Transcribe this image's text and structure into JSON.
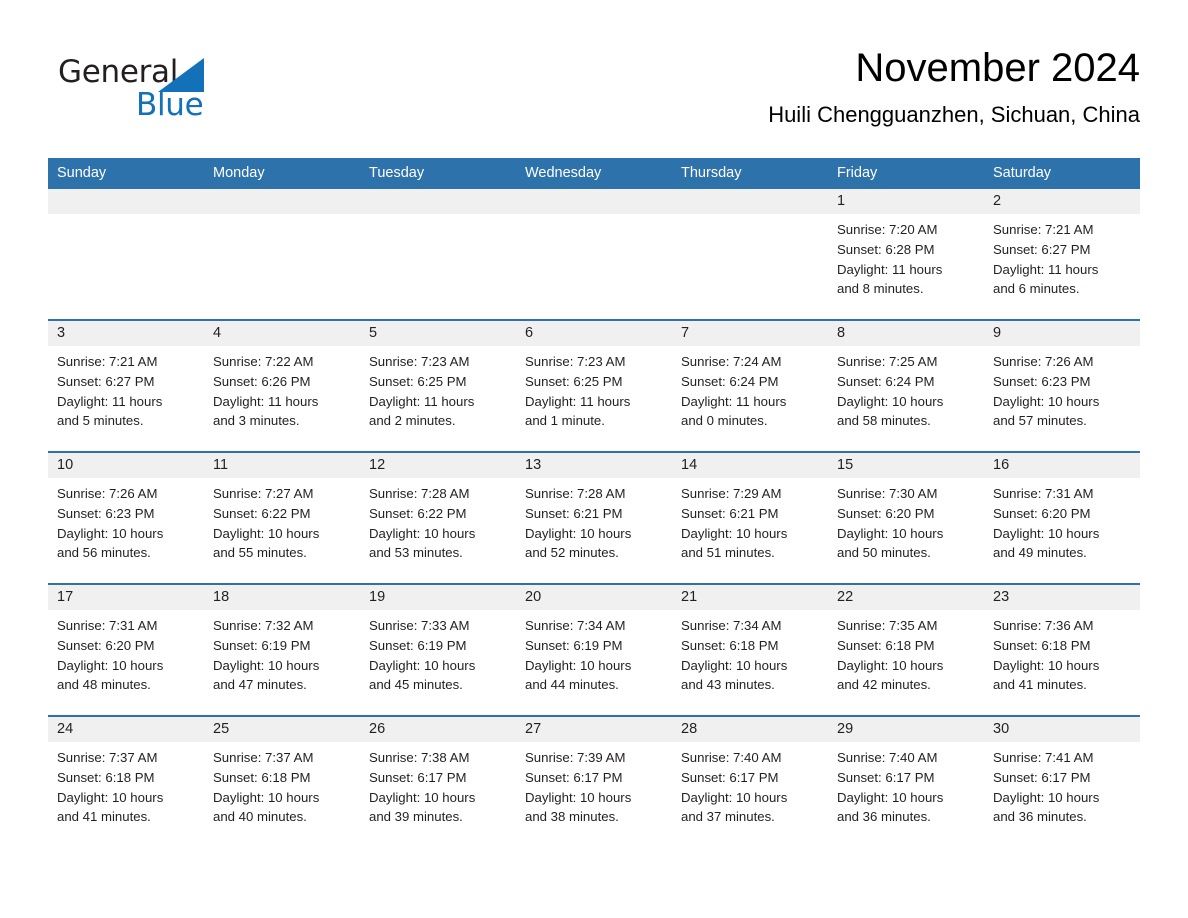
{
  "brand": {
    "word1": "General",
    "word2": "Blue",
    "triangle_color": "#1271b8",
    "text_color": "#231f20",
    "logo_icon": "triangle-play-icon"
  },
  "header": {
    "month_title": "November 2024",
    "location": "Huili Chengguanzhen, Sichuan, China"
  },
  "theme": {
    "header_blue": "#2e72ab",
    "row_divider_blue": "#2e72ab",
    "daynum_band": "#f0f0f0",
    "text": "#231f20",
    "background": "#ffffff"
  },
  "weekday_headers": [
    "Sunday",
    "Monday",
    "Tuesday",
    "Wednesday",
    "Thursday",
    "Friday",
    "Saturday"
  ],
  "weeks": [
    [
      {
        "day": "",
        "sunrise": "",
        "sunset": "",
        "daylight_1": "",
        "daylight_2": ""
      },
      {
        "day": "",
        "sunrise": "",
        "sunset": "",
        "daylight_1": "",
        "daylight_2": ""
      },
      {
        "day": "",
        "sunrise": "",
        "sunset": "",
        "daylight_1": "",
        "daylight_2": ""
      },
      {
        "day": "",
        "sunrise": "",
        "sunset": "",
        "daylight_1": "",
        "daylight_2": ""
      },
      {
        "day": "",
        "sunrise": "",
        "sunset": "",
        "daylight_1": "",
        "daylight_2": ""
      },
      {
        "day": "1",
        "sunrise": "Sunrise: 7:20 AM",
        "sunset": "Sunset: 6:28 PM",
        "daylight_1": "Daylight: 11 hours",
        "daylight_2": "and 8 minutes."
      },
      {
        "day": "2",
        "sunrise": "Sunrise: 7:21 AM",
        "sunset": "Sunset: 6:27 PM",
        "daylight_1": "Daylight: 11 hours",
        "daylight_2": "and 6 minutes."
      }
    ],
    [
      {
        "day": "3",
        "sunrise": "Sunrise: 7:21 AM",
        "sunset": "Sunset: 6:27 PM",
        "daylight_1": "Daylight: 11 hours",
        "daylight_2": "and 5 minutes."
      },
      {
        "day": "4",
        "sunrise": "Sunrise: 7:22 AM",
        "sunset": "Sunset: 6:26 PM",
        "daylight_1": "Daylight: 11 hours",
        "daylight_2": "and 3 minutes."
      },
      {
        "day": "5",
        "sunrise": "Sunrise: 7:23 AM",
        "sunset": "Sunset: 6:25 PM",
        "daylight_1": "Daylight: 11 hours",
        "daylight_2": "and 2 minutes."
      },
      {
        "day": "6",
        "sunrise": "Sunrise: 7:23 AM",
        "sunset": "Sunset: 6:25 PM",
        "daylight_1": "Daylight: 11 hours",
        "daylight_2": "and 1 minute."
      },
      {
        "day": "7",
        "sunrise": "Sunrise: 7:24 AM",
        "sunset": "Sunset: 6:24 PM",
        "daylight_1": "Daylight: 11 hours",
        "daylight_2": "and 0 minutes."
      },
      {
        "day": "8",
        "sunrise": "Sunrise: 7:25 AM",
        "sunset": "Sunset: 6:24 PM",
        "daylight_1": "Daylight: 10 hours",
        "daylight_2": "and 58 minutes."
      },
      {
        "day": "9",
        "sunrise": "Sunrise: 7:26 AM",
        "sunset": "Sunset: 6:23 PM",
        "daylight_1": "Daylight: 10 hours",
        "daylight_2": "and 57 minutes."
      }
    ],
    [
      {
        "day": "10",
        "sunrise": "Sunrise: 7:26 AM",
        "sunset": "Sunset: 6:23 PM",
        "daylight_1": "Daylight: 10 hours",
        "daylight_2": "and 56 minutes."
      },
      {
        "day": "11",
        "sunrise": "Sunrise: 7:27 AM",
        "sunset": "Sunset: 6:22 PM",
        "daylight_1": "Daylight: 10 hours",
        "daylight_2": "and 55 minutes."
      },
      {
        "day": "12",
        "sunrise": "Sunrise: 7:28 AM",
        "sunset": "Sunset: 6:22 PM",
        "daylight_1": "Daylight: 10 hours",
        "daylight_2": "and 53 minutes."
      },
      {
        "day": "13",
        "sunrise": "Sunrise: 7:28 AM",
        "sunset": "Sunset: 6:21 PM",
        "daylight_1": "Daylight: 10 hours",
        "daylight_2": "and 52 minutes."
      },
      {
        "day": "14",
        "sunrise": "Sunrise: 7:29 AM",
        "sunset": "Sunset: 6:21 PM",
        "daylight_1": "Daylight: 10 hours",
        "daylight_2": "and 51 minutes."
      },
      {
        "day": "15",
        "sunrise": "Sunrise: 7:30 AM",
        "sunset": "Sunset: 6:20 PM",
        "daylight_1": "Daylight: 10 hours",
        "daylight_2": "and 50 minutes."
      },
      {
        "day": "16",
        "sunrise": "Sunrise: 7:31 AM",
        "sunset": "Sunset: 6:20 PM",
        "daylight_1": "Daylight: 10 hours",
        "daylight_2": "and 49 minutes."
      }
    ],
    [
      {
        "day": "17",
        "sunrise": "Sunrise: 7:31 AM",
        "sunset": "Sunset: 6:20 PM",
        "daylight_1": "Daylight: 10 hours",
        "daylight_2": "and 48 minutes."
      },
      {
        "day": "18",
        "sunrise": "Sunrise: 7:32 AM",
        "sunset": "Sunset: 6:19 PM",
        "daylight_1": "Daylight: 10 hours",
        "daylight_2": "and 47 minutes."
      },
      {
        "day": "19",
        "sunrise": "Sunrise: 7:33 AM",
        "sunset": "Sunset: 6:19 PM",
        "daylight_1": "Daylight: 10 hours",
        "daylight_2": "and 45 minutes."
      },
      {
        "day": "20",
        "sunrise": "Sunrise: 7:34 AM",
        "sunset": "Sunset: 6:19 PM",
        "daylight_1": "Daylight: 10 hours",
        "daylight_2": "and 44 minutes."
      },
      {
        "day": "21",
        "sunrise": "Sunrise: 7:34 AM",
        "sunset": "Sunset: 6:18 PM",
        "daylight_1": "Daylight: 10 hours",
        "daylight_2": "and 43 minutes."
      },
      {
        "day": "22",
        "sunrise": "Sunrise: 7:35 AM",
        "sunset": "Sunset: 6:18 PM",
        "daylight_1": "Daylight: 10 hours",
        "daylight_2": "and 42 minutes."
      },
      {
        "day": "23",
        "sunrise": "Sunrise: 7:36 AM",
        "sunset": "Sunset: 6:18 PM",
        "daylight_1": "Daylight: 10 hours",
        "daylight_2": "and 41 minutes."
      }
    ],
    [
      {
        "day": "24",
        "sunrise": "Sunrise: 7:37 AM",
        "sunset": "Sunset: 6:18 PM",
        "daylight_1": "Daylight: 10 hours",
        "daylight_2": "and 41 minutes."
      },
      {
        "day": "25",
        "sunrise": "Sunrise: 7:37 AM",
        "sunset": "Sunset: 6:18 PM",
        "daylight_1": "Daylight: 10 hours",
        "daylight_2": "and 40 minutes."
      },
      {
        "day": "26",
        "sunrise": "Sunrise: 7:38 AM",
        "sunset": "Sunset: 6:17 PM",
        "daylight_1": "Daylight: 10 hours",
        "daylight_2": "and 39 minutes."
      },
      {
        "day": "27",
        "sunrise": "Sunrise: 7:39 AM",
        "sunset": "Sunset: 6:17 PM",
        "daylight_1": "Daylight: 10 hours",
        "daylight_2": "and 38 minutes."
      },
      {
        "day": "28",
        "sunrise": "Sunrise: 7:40 AM",
        "sunset": "Sunset: 6:17 PM",
        "daylight_1": "Daylight: 10 hours",
        "daylight_2": "and 37 minutes."
      },
      {
        "day": "29",
        "sunrise": "Sunrise: 7:40 AM",
        "sunset": "Sunset: 6:17 PM",
        "daylight_1": "Daylight: 10 hours",
        "daylight_2": "and 36 minutes."
      },
      {
        "day": "30",
        "sunrise": "Sunrise: 7:41 AM",
        "sunset": "Sunset: 6:17 PM",
        "daylight_1": "Daylight: 10 hours",
        "daylight_2": "and 36 minutes."
      }
    ]
  ]
}
